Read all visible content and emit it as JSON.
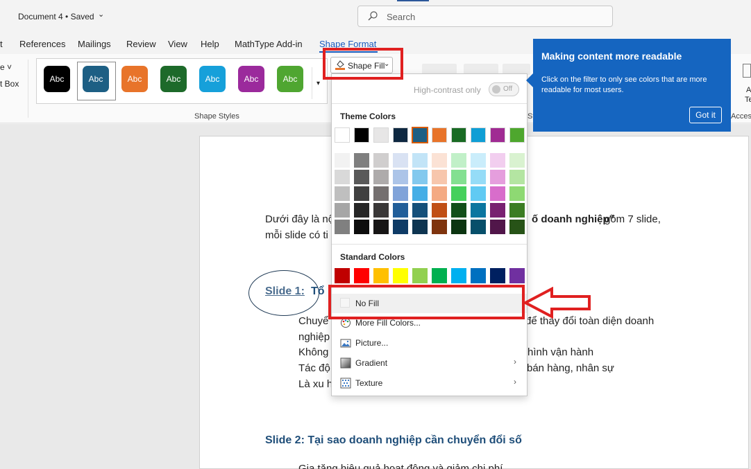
{
  "titlebar": {
    "doc_title": "Document 4 • Saved",
    "search_placeholder": "Search"
  },
  "tabs": [
    {
      "label": "t"
    },
    {
      "label": "References"
    },
    {
      "label": "Mailings"
    },
    {
      "label": "Review"
    },
    {
      "label": "View"
    },
    {
      "label": "Help"
    },
    {
      "label": "MathType Add-in"
    },
    {
      "label": "Shape Format",
      "active": true
    }
  ],
  "ribbon": {
    "left_partial_1": "e ˅",
    "left_partial_2": "t Box",
    "group_label": "Shape Styles",
    "partial_st": "St",
    "partial_acces": "Acces",
    "partial_a": "A",
    "partial_te": "Te",
    "style_swatches": [
      {
        "label": "Abc",
        "color": "#000000"
      },
      {
        "label": "Abc",
        "color": "#1d5f84",
        "selected": true
      },
      {
        "label": "Abc",
        "color": "#e8742a"
      },
      {
        "label": "Abc",
        "color": "#1d6a2a"
      },
      {
        "label": "Abc",
        "color": "#16a0da"
      },
      {
        "label": "Abc",
        "color": "#9b2a9c"
      },
      {
        "label": "Abc",
        "color": "#4fa631"
      }
    ],
    "shape_fill_label": "Shape Fill"
  },
  "menu": {
    "high_contrast_label": "High-contrast only",
    "toggle_label": "Off",
    "theme_colors_title": "Theme Colors",
    "standard_colors_title": "Standard Colors",
    "theme_top_row": [
      "#ffffff",
      "#000000",
      "#e7e6e6",
      "#0e2841",
      "#1d5f84",
      "#e8742a",
      "#196b24",
      "#0f9ed5",
      "#a02b93",
      "#4ea72e"
    ],
    "theme_shades": [
      [
        "#f2f2f2",
        "#7f7f7f",
        "#d0cece",
        "#d9e2f3",
        "#c2e4f7",
        "#fbe2d5",
        "#c1f0c8",
        "#caedfb",
        "#f2ceef",
        "#d9f2d0"
      ],
      [
        "#d9d9d9",
        "#595959",
        "#aeabab",
        "#acc4e8",
        "#83c9ee",
        "#f7c6ac",
        "#83e091",
        "#95dcf7",
        "#e59edd",
        "#b4e5a2"
      ],
      [
        "#bfbfbf",
        "#404040",
        "#757070",
        "#80a3d9",
        "#45aee6",
        "#f4aa83",
        "#45d05c",
        "#60caf3",
        "#d86dcb",
        "#8ed973"
      ],
      [
        "#a6a6a6",
        "#262626",
        "#3a3838",
        "#215e99",
        "#15507a",
        "#c04f15",
        "#124f1a",
        "#0b76a0",
        "#782170",
        "#3b7d23"
      ],
      [
        "#808080",
        "#0d0d0d",
        "#171616",
        "#0e3b66",
        "#0e3551",
        "#7f340e",
        "#0c3511",
        "#074f6a",
        "#51164a",
        "#275317"
      ]
    ],
    "standard_colors": [
      "#c00000",
      "#ff0000",
      "#ffc000",
      "#ffff00",
      "#92d050",
      "#00b050",
      "#00b0f0",
      "#0070c0",
      "#002060",
      "#7030a0"
    ],
    "items": [
      {
        "label": "No Fill",
        "icon": "no-fill-icon"
      },
      {
        "label": "More Fill Colors...",
        "icon": "palette-icon"
      },
      {
        "label": "Picture...",
        "icon": "picture-icon"
      },
      {
        "label": "Gradient",
        "icon": "gradient-icon",
        "submenu": true
      },
      {
        "label": "Texture",
        "icon": "texture-icon",
        "submenu": true
      }
    ]
  },
  "callout": {
    "title": "Making content more readable",
    "body": "Click on the filter to only see colors that are more readable for most users.",
    "button": "Got it"
  },
  "document": {
    "intro_line1_left": "Dưới đây là nộ",
    "intro_line1_right_bold": "ố doanh nghiệp”",
    "intro_line1_right": " gồm 7 slide,",
    "intro_line2": "mỗi slide có ti",
    "slide1_label": "Slide 1:",
    "slide1_rest": " Tổ",
    "bullets_left": [
      "Chuyể",
      "nghiệp",
      "Không",
      "Tác độ",
      "Là xu h"
    ],
    "bullets_right": [
      "để thay đổi toàn diện doanh",
      "",
      "hình vận hành",
      "bán hàng, nhân sự",
      ""
    ],
    "slide2_heading": "Slide 2: Tại sao doanh nghiệp cần chuyển đổi số",
    "slide2_partial": "Gia tăng hiệu quả hoạt động và giảm chi phí"
  }
}
